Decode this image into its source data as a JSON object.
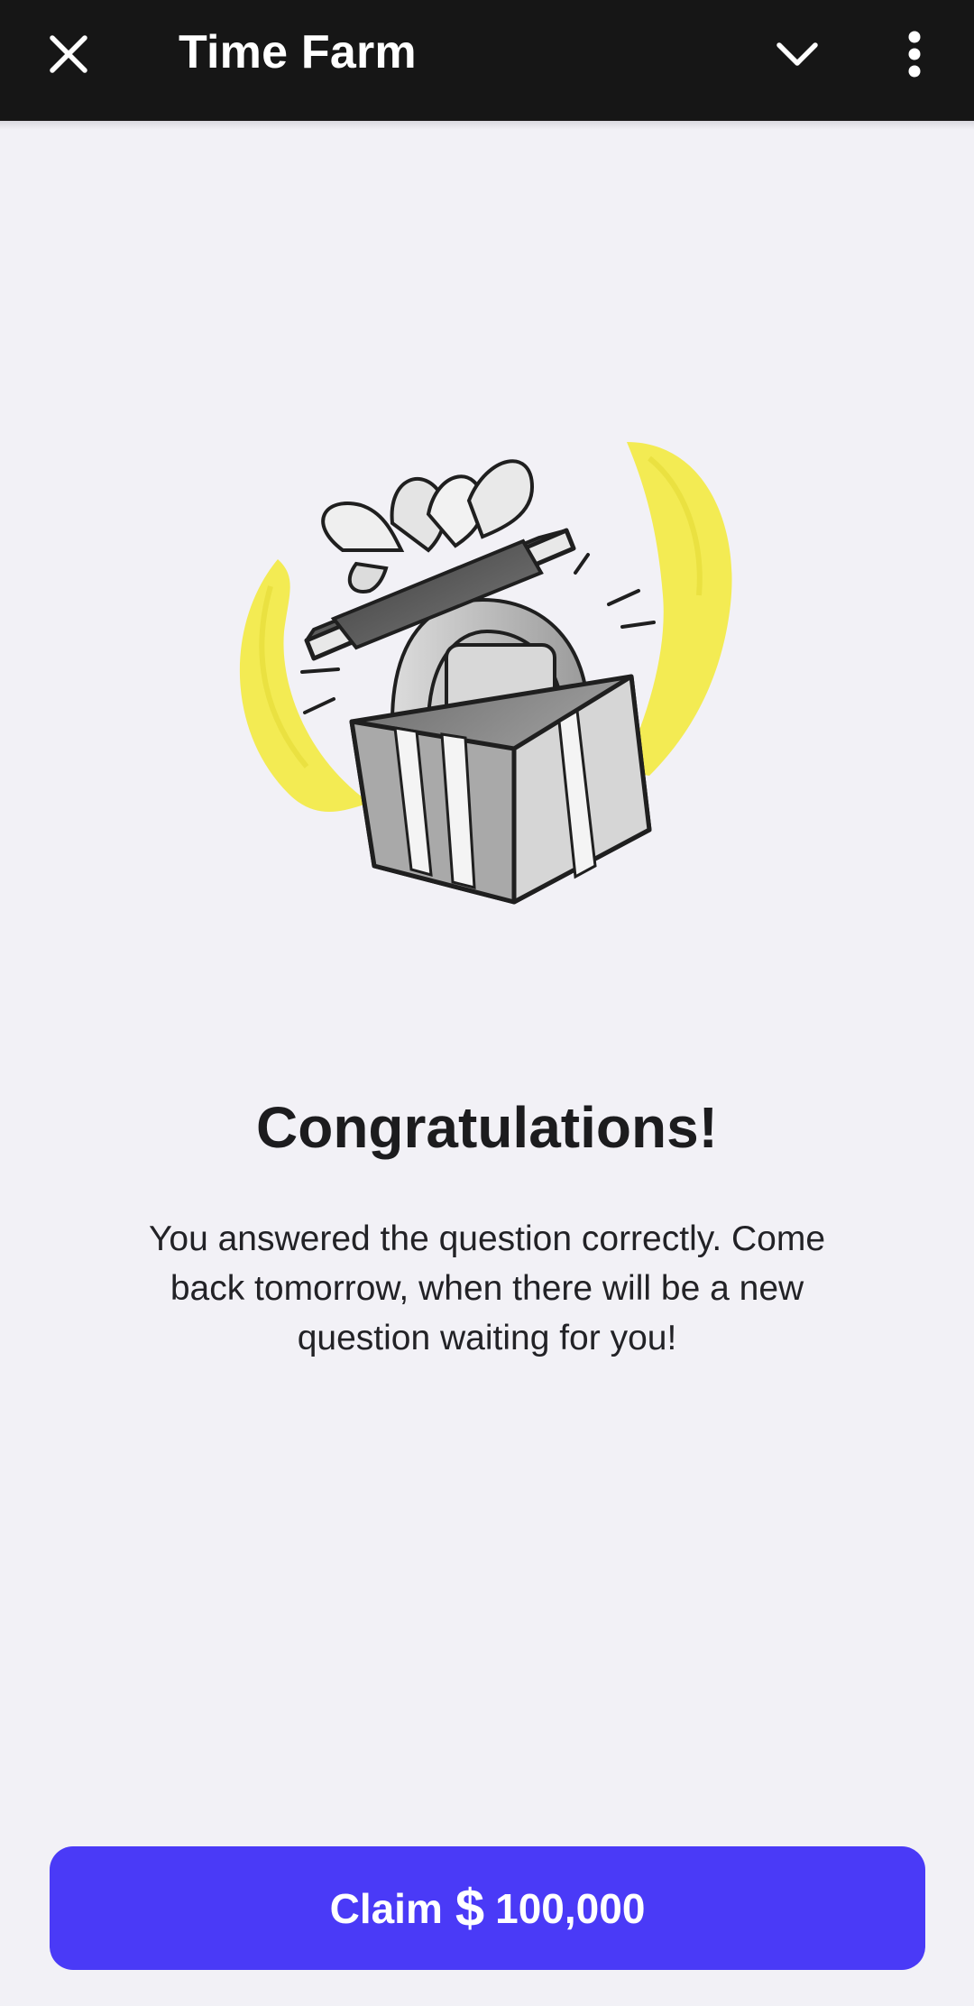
{
  "header": {
    "title": "Time Farm",
    "close_icon": "close-icon",
    "chevron_icon": "chevron-down-icon",
    "menu_icon": "more-vertical-icon"
  },
  "main": {
    "illustration": "gift-box-illustration",
    "headline": "Congratulations!",
    "message": "You answered the question correctly. Come back tomorrow, when there will be a new question waiting for you!"
  },
  "claim_button": {
    "label": "Claim",
    "currency_icon": "dollar-coin-icon",
    "currency_symbol": "$",
    "amount": "100,000"
  },
  "colors": {
    "topbar": "#161616",
    "background": "#f2f1f6",
    "accent": "#4a3af7",
    "highlight": "#f2ea4a"
  }
}
